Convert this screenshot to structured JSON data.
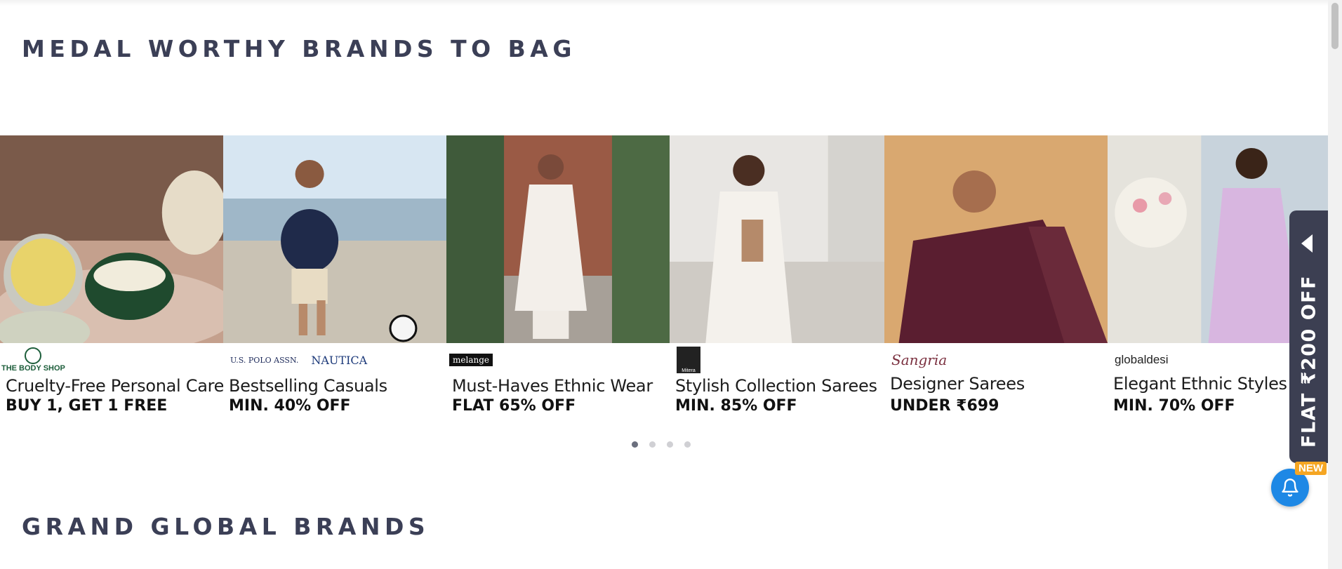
{
  "sections": {
    "medal_title": "MEDAL WORTHY BRANDS TO BAG",
    "grand_title": "GRAND GLOBAL BRANDS"
  },
  "cards": [
    {
      "logo": "THE BODY SHOP",
      "title": "Cruelty-Free Personal Care",
      "offer": "BUY 1, GET 1 FREE"
    },
    {
      "logo": "U.S. POLO ASSN.",
      "logo2": "NAUTICA",
      "title": "Bestselling Casuals",
      "offer": "MIN. 40% OFF"
    },
    {
      "logo": "melange",
      "title": "Must-Haves Ethnic Wear",
      "offer": "FLAT 65% OFF"
    },
    {
      "logo": "Mitera",
      "title": "Stylish Collection Sarees",
      "offer": "MIN. 85% OFF"
    },
    {
      "logo": "Sangria",
      "title": "Designer Sarees",
      "offer": "UNDER ₹699"
    },
    {
      "logo": "globaldesi",
      "title": "Elegant Ethnic Styles",
      "offer": "MIN. 70% OFF"
    }
  ],
  "carousel": {
    "pages": 4,
    "active_page": 1
  },
  "promo": {
    "flat_offer": "FLAT ₹200 OFF",
    "new_badge": "NEW"
  },
  "colors": {
    "heading": "#3b3f56",
    "tab_bg": "#3c3f52",
    "bell": "#1e88e5",
    "badge": "#f5a623"
  },
  "icons": [
    "chevron-left-icon",
    "bell-icon"
  ]
}
